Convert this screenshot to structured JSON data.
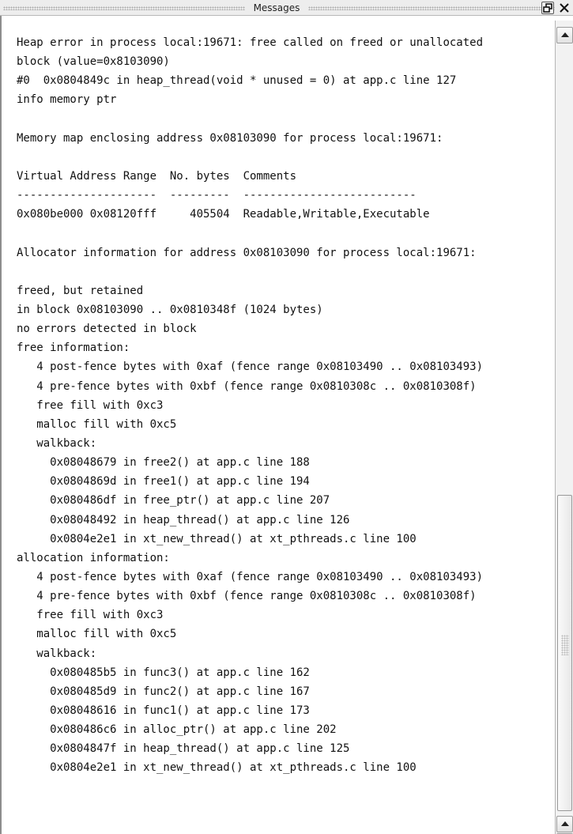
{
  "window": {
    "title": "Messages"
  },
  "icons": {
    "restore": "restore-icon",
    "close": "close-icon",
    "scroll_up": "chevron-up-icon",
    "scroll_down": "chevron-down-icon"
  },
  "log": {
    "lines": [
      "Heap error in process local:19671: free called on freed or unallocated",
      "block (value=0x8103090)",
      "#0  0x0804849c in heap_thread(void * unused = 0) at app.c line 127",
      "info memory ptr",
      "",
      "Memory map enclosing address 0x08103090 for process local:19671:",
      "",
      "Virtual Address Range  No. bytes  Comments",
      "---------------------  ---------  --------------------------",
      "0x080be000 0x08120fff     405504  Readable,Writable,Executable",
      "",
      "Allocator information for address 0x08103090 for process local:19671:",
      "",
      "freed, but retained",
      "in block 0x08103090 .. 0x0810348f (1024 bytes)",
      "no errors detected in block",
      "free information:",
      "   4 post-fence bytes with 0xaf (fence range 0x08103490 .. 0x08103493)",
      "   4 pre-fence bytes with 0xbf (fence range 0x0810308c .. 0x0810308f)",
      "   free fill with 0xc3",
      "   malloc fill with 0xc5",
      "   walkback:",
      "     0x08048679 in free2() at app.c line 188",
      "     0x0804869d in free1() at app.c line 194",
      "     0x080486df in free_ptr() at app.c line 207",
      "     0x08048492 in heap_thread() at app.c line 126",
      "     0x0804e2e1 in xt_new_thread() at xt_pthreads.c line 100",
      "allocation information:",
      "   4 post-fence bytes with 0xaf (fence range 0x08103490 .. 0x08103493)",
      "   4 pre-fence bytes with 0xbf (fence range 0x0810308c .. 0x0810308f)",
      "   free fill with 0xc3",
      "   malloc fill with 0xc5",
      "   walkback:",
      "     0x080485b5 in func3() at app.c line 162",
      "     0x080485d9 in func2() at app.c line 167",
      "     0x08048616 in func1() at app.c line 173",
      "     0x080486c6 in alloc_ptr() at app.c line 202",
      "     0x0804847f in heap_thread() at app.c line 125",
      "     0x0804e2e1 in xt_new_thread() at xt_pthreads.c line 100"
    ]
  }
}
